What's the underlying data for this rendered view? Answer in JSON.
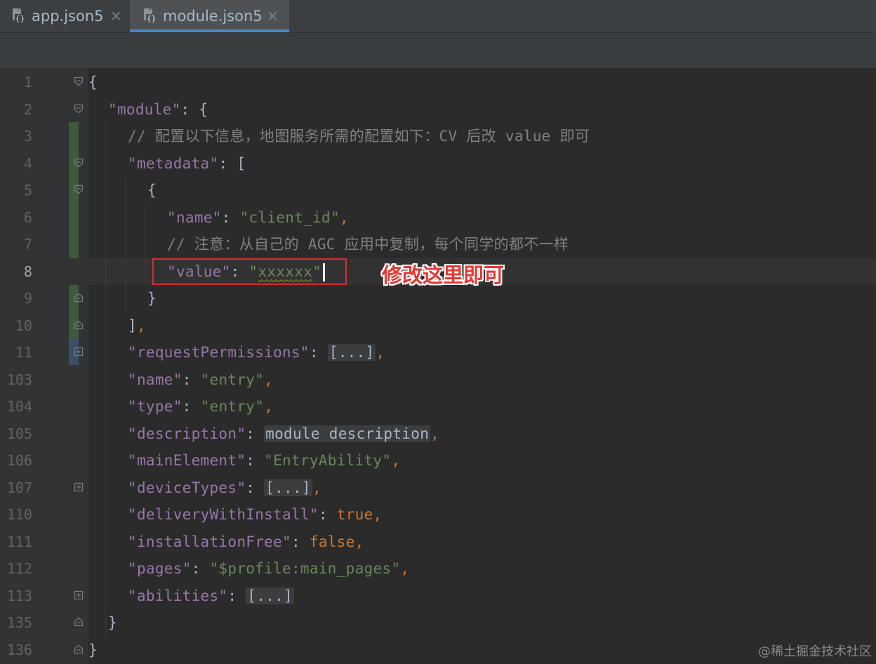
{
  "tabs": [
    {
      "label": "app.json5",
      "active": false,
      "icon": "json5-file-icon"
    },
    {
      "label": "module.json5",
      "active": true,
      "icon": "json5-file-icon"
    }
  ],
  "colors": {
    "background": "#2b2b2b",
    "key": "#9876aa",
    "string": "#6a8759",
    "keyword": "#cc7832",
    "comment": "#808080",
    "annotation": "#e53935",
    "highlight_box": "#d32f2f",
    "tab_accent": "#4a88c7"
  },
  "editor": {
    "current_line": "8",
    "lines": [
      {
        "num": "1",
        "fold": "fold-open",
        "tokens": [
          {
            "t": "{",
            "c": "plain"
          }
        ]
      },
      {
        "num": "2",
        "fold": "fold-open",
        "tokens": [
          {
            "t": "\"module\"",
            "c": "k"
          },
          {
            "t": ": {",
            "c": "plain"
          }
        ]
      },
      {
        "num": "3",
        "fold": "",
        "tokens": [
          {
            "t": "// 配置以下信息，地图服务所需的配置如下：CV 后改 value 即可",
            "c": "c"
          }
        ]
      },
      {
        "num": "4",
        "fold": "fold-open",
        "tokens": [
          {
            "t": "\"metadata\"",
            "c": "k"
          },
          {
            "t": ": [",
            "c": "plain"
          }
        ]
      },
      {
        "num": "5",
        "fold": "fold-open",
        "tokens": [
          {
            "t": "{",
            "c": "plain"
          }
        ]
      },
      {
        "num": "6",
        "fold": "",
        "tokens": [
          {
            "t": "\"name\"",
            "c": "k"
          },
          {
            "t": ": ",
            "c": "plain"
          },
          {
            "t": "\"client_id\"",
            "c": "s"
          },
          {
            "t": ",",
            "c": "p"
          }
        ]
      },
      {
        "num": "7",
        "fold": "",
        "tokens": [
          {
            "t": "// 注意：从自己的 AGC 应用中复制，每个同学的都不一样",
            "c": "c"
          }
        ]
      },
      {
        "num": "8",
        "fold": "",
        "tokens": [
          {
            "t": "\"value\"",
            "c": "k"
          },
          {
            "t": ": ",
            "c": "plain"
          },
          {
            "t": "\"",
            "c": "s"
          },
          {
            "t": "xxxxxx",
            "c": "s wavy"
          },
          {
            "t": "\"",
            "c": "s"
          }
        ]
      },
      {
        "num": "9",
        "fold": "fold-close",
        "tokens": [
          {
            "t": "}",
            "c": "plain"
          }
        ]
      },
      {
        "num": "10",
        "fold": "fold-close",
        "tokens": [
          {
            "t": "]",
            "c": "plain"
          },
          {
            "t": ",",
            "c": "p"
          }
        ]
      },
      {
        "num": "11",
        "fold": "fold-plus",
        "tokens": [
          {
            "t": "\"requestPermissions\"",
            "c": "k"
          },
          {
            "t": ": ",
            "c": "plain"
          },
          {
            "t": "[...]",
            "c": "fold-box"
          },
          {
            "t": ",",
            "c": "p"
          }
        ]
      },
      {
        "num": "103",
        "fold": "",
        "tokens": [
          {
            "t": "\"name\"",
            "c": "k"
          },
          {
            "t": ": ",
            "c": "plain"
          },
          {
            "t": "\"entry\"",
            "c": "s"
          },
          {
            "t": ",",
            "c": "p"
          }
        ]
      },
      {
        "num": "104",
        "fold": "",
        "tokens": [
          {
            "t": "\"type\"",
            "c": "k"
          },
          {
            "t": ": ",
            "c": "plain"
          },
          {
            "t": "\"entry\"",
            "c": "s"
          },
          {
            "t": ",",
            "c": "p"
          }
        ]
      },
      {
        "num": "105",
        "fold": "",
        "tokens": [
          {
            "t": "\"description\"",
            "c": "k"
          },
          {
            "t": ": ",
            "c": "plain"
          },
          {
            "t": "module description",
            "c": "fold-box"
          },
          {
            "t": ",",
            "c": "p"
          }
        ]
      },
      {
        "num": "106",
        "fold": "",
        "tokens": [
          {
            "t": "\"mainElement\"",
            "c": "k"
          },
          {
            "t": ": ",
            "c": "plain"
          },
          {
            "t": "\"EntryAbility\"",
            "c": "s"
          },
          {
            "t": ",",
            "c": "p"
          }
        ]
      },
      {
        "num": "107",
        "fold": "fold-plus",
        "tokens": [
          {
            "t": "\"deviceTypes\"",
            "c": "k"
          },
          {
            "t": ": ",
            "c": "plain"
          },
          {
            "t": "[...]",
            "c": "fold-box"
          },
          {
            "t": ",",
            "c": "p"
          }
        ]
      },
      {
        "num": "110",
        "fold": "",
        "tokens": [
          {
            "t": "\"deliveryWithInstall\"",
            "c": "k"
          },
          {
            "t": ": ",
            "c": "plain"
          },
          {
            "t": "true",
            "c": "kw"
          },
          {
            "t": ",",
            "c": "p"
          }
        ]
      },
      {
        "num": "111",
        "fold": "",
        "tokens": [
          {
            "t": "\"installationFree\"",
            "c": "k"
          },
          {
            "t": ": ",
            "c": "plain"
          },
          {
            "t": "false",
            "c": "kw"
          },
          {
            "t": ",",
            "c": "p"
          }
        ]
      },
      {
        "num": "112",
        "fold": "",
        "tokens": [
          {
            "t": "\"pages\"",
            "c": "k"
          },
          {
            "t": ": ",
            "c": "plain"
          },
          {
            "t": "\"$profile:main_pages\"",
            "c": "s"
          },
          {
            "t": ",",
            "c": "p"
          }
        ]
      },
      {
        "num": "113",
        "fold": "fold-plus",
        "tokens": [
          {
            "t": "\"abilities\"",
            "c": "k"
          },
          {
            "t": ": ",
            "c": "plain"
          },
          {
            "t": "[...]",
            "c": "fold-box"
          }
        ]
      },
      {
        "num": "135",
        "fold": "fold-close",
        "tokens": [
          {
            "t": "}",
            "c": "plain"
          }
        ]
      },
      {
        "num": "136",
        "fold": "fold-close",
        "tokens": [
          {
            "t": "}",
            "c": "plain"
          }
        ]
      }
    ]
  },
  "annotation": {
    "text": "修改这里即可"
  },
  "watermark": {
    "text": "@稀土掘金技术社区"
  }
}
